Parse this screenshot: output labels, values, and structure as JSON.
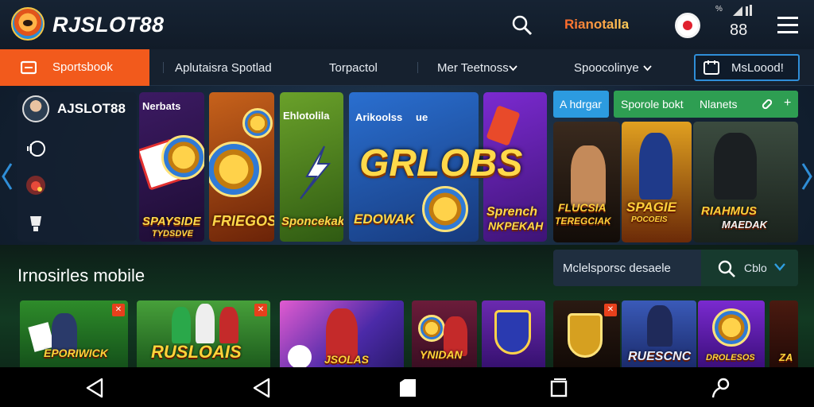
{
  "header": {
    "brand": "RJSLOT88",
    "promo": "Rianotalla",
    "status_mini": "%",
    "balance": "88"
  },
  "nav": {
    "active": "Sportsbook",
    "items": [
      "Aplutaisra Spotlad",
      "Torpactol",
      "Mer Teetnoss",
      "Spoocolinye"
    ],
    "button": "MsLoood!"
  },
  "profile": {
    "name": "AJSLOT88"
  },
  "banners": {
    "card1_top": "Nerbats",
    "card1_label": "SPAYSIDE",
    "card1_sub": "TYDSDVE",
    "card2_label": "FRIEGOS",
    "card3_top": "Ehlotolila",
    "card3_label": "Sponcekak",
    "card4_top": "Arikoolss",
    "card4_top2": "ue",
    "card4_title": "GRLOBS",
    "card4_label": "EDOWAK",
    "card5_label": "Sprench",
    "card5_sub": "NKPEKAH"
  },
  "sports": {
    "tab_blue": "A hdrgar",
    "tab_green_a": "Sporole bokt",
    "tab_green_b": "Nlanets",
    "card1_label": "FLUCSIA",
    "card1_sub": "TEREGCIAK",
    "card2_label": "SPAGIE",
    "card2_sub": "POCOEIS",
    "card3_label": "RIAHMUS",
    "card3_sub": "MAEDAK"
  },
  "section": {
    "title": "Irnosirles mobile"
  },
  "search": {
    "placeholder": "Mclelsporsc desaele",
    "filter": "Cblo"
  },
  "thumbs": {
    "t1_label": "EPORIWICK",
    "t2_label": "RUSLOAIS",
    "t3_label": "JSOLAS",
    "t4_label": "YNIDAN",
    "t7_label": "RUESCNC",
    "t8_label": "DROLESOS",
    "t9_label": "ZA"
  },
  "colors": {
    "accent_orange": "#f25a1c",
    "accent_green": "#2e9e52",
    "accent_blue": "#2c9be0",
    "bg_dark": "#0b1420"
  }
}
